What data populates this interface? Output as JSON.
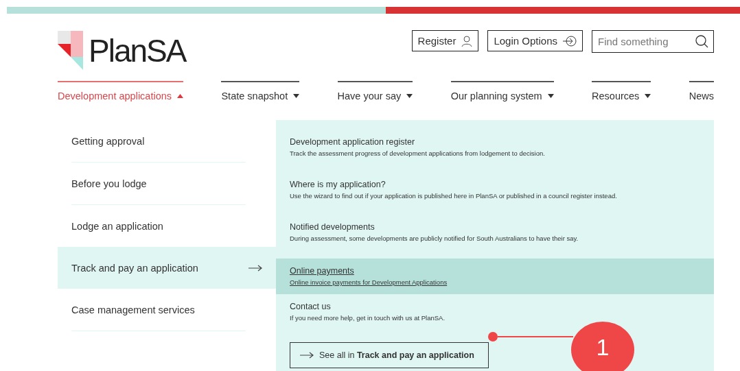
{
  "brand": {
    "name": "PlanSA"
  },
  "header": {
    "buttons": [
      {
        "label": "Register",
        "kind": "user"
      },
      {
        "label": "Login Options",
        "kind": "login"
      }
    ],
    "search": {
      "placeholder": "Find something"
    }
  },
  "nav": [
    {
      "label": "Development applications",
      "selected": true,
      "kind": "menu"
    },
    {
      "label": "State snapshot",
      "selected": false,
      "kind": "menu"
    },
    {
      "label": "Have your say",
      "selected": false,
      "kind": "menu"
    },
    {
      "label": "Our planning system",
      "selected": false,
      "kind": "menu"
    },
    {
      "label": "Resources",
      "selected": false,
      "kind": "menu"
    },
    {
      "label": "News",
      "selected": false,
      "kind": "link"
    }
  ],
  "submenu": [
    {
      "label": "Getting approval",
      "selected": false
    },
    {
      "label": "Before you lodge",
      "selected": false
    },
    {
      "label": "Lodge an application",
      "selected": false
    },
    {
      "label": "Track and pay an application",
      "selected": true
    },
    {
      "label": "Case management services",
      "selected": false
    }
  ],
  "links": [
    {
      "title": "Development application register",
      "description": "Track the assessment progress of development applications from lodgement to decision.",
      "selected": false
    },
    {
      "title": "Where is my application?",
      "description": "Use the wizard to find out if your application is published here in PlanSA or published in a council register instead.",
      "selected": false
    },
    {
      "title": "Notified developments",
      "description": "During assessment, some developments are publicly notified for South Australians to have their say.",
      "selected": false
    },
    {
      "title": "Online payments",
      "description": "Online invoice payments for Development Applications",
      "selected": true
    },
    {
      "title": "Contact us",
      "description": "If you need more help, get in touch with us at PlanSA.",
      "selected": false
    }
  ],
  "see_all": {
    "label": "See all in **Track and pay an application**"
  },
  "callout": {
    "label": "1"
  }
}
